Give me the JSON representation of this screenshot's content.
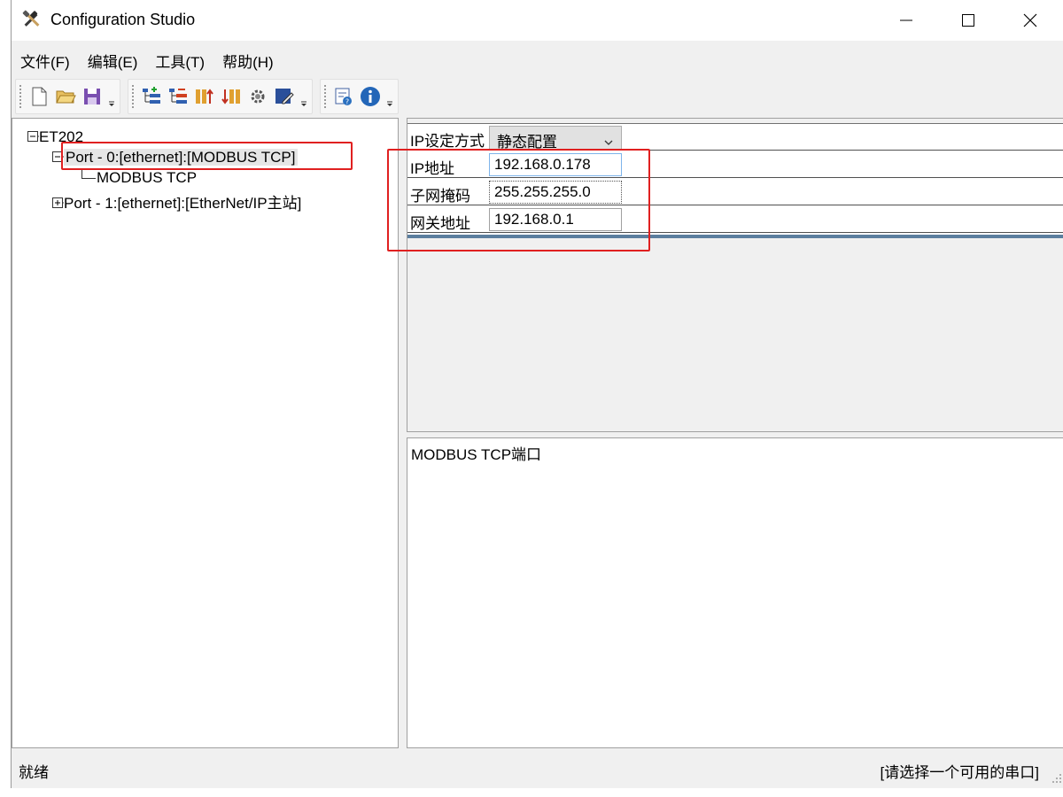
{
  "window": {
    "title": "Configuration Studio",
    "icon": "hammer-wrench-icon"
  },
  "menu": [
    {
      "label": "文件(F)"
    },
    {
      "label": "编辑(E)"
    },
    {
      "label": "工具(T)"
    },
    {
      "label": "帮助(H)"
    }
  ],
  "toolbar": {
    "group1": [
      "new-file-icon",
      "open-folder-icon",
      "save-icon"
    ],
    "group2": [
      "add-device-icon",
      "remove-device-icon",
      "upload-icon",
      "download-icon",
      "settings-gear-icon",
      "edit-icon"
    ],
    "group3": [
      "help-context-icon",
      "info-icon"
    ]
  },
  "tree": {
    "root": {
      "label": "ET202"
    },
    "port0": {
      "label": "Port - 0:[ethernet]:[MODBUS TCP]",
      "selected": true
    },
    "port0_child": {
      "label": "MODBUS TCP"
    },
    "port1": {
      "label": "Port - 1:[ethernet]:[EtherNet/IP主站]"
    }
  },
  "properties": {
    "ip_mode": {
      "label": "IP设定方式",
      "value": "静态配置"
    },
    "ip_address": {
      "label": "IP地址",
      "value": "192.168.0.178"
    },
    "subnet_mask": {
      "label": "子网掩码",
      "value": "255.255.255.0"
    },
    "gateway": {
      "label": "网关地址",
      "value": "192.168.0.1"
    }
  },
  "description": {
    "text": "MODBUS TCP端口"
  },
  "status": {
    "left": "就绪",
    "right": "[请选择一个可用的串口]"
  },
  "colors": {
    "highlight_box": "#e02020",
    "splitter": "#5b7e9e",
    "focus_border": "#7eb4ea"
  }
}
